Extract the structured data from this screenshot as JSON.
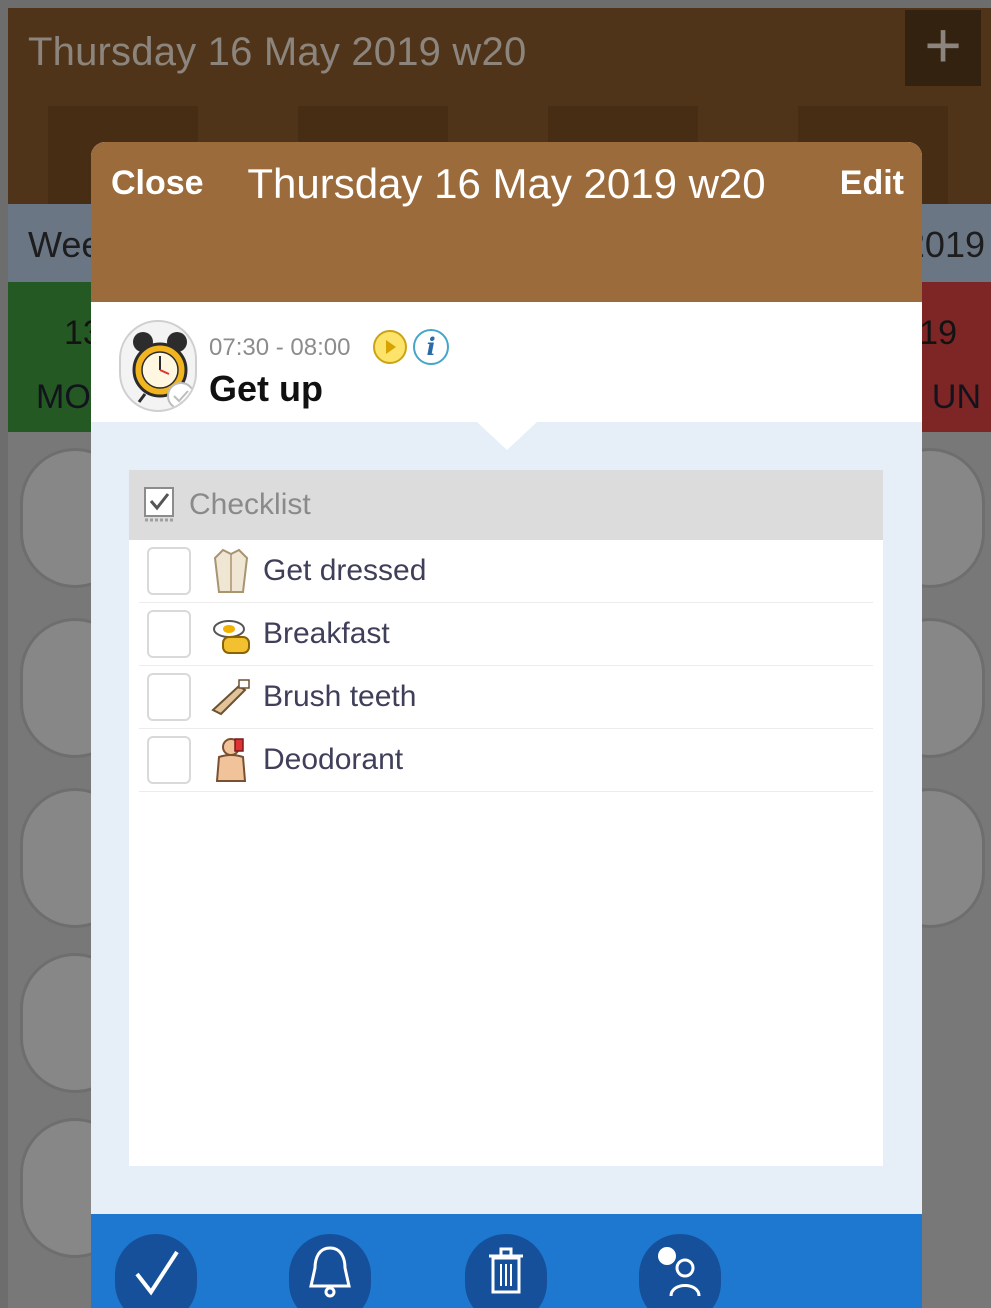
{
  "background": {
    "title": "Thursday 16 May 2019 w20",
    "add_label": "+",
    "week_left": "Wee",
    "week_right": "2019",
    "day_left_num": "13",
    "day_left_label": "MO",
    "day_right_num": "19",
    "day_right_label": "UN"
  },
  "modal": {
    "close_label": "Close",
    "title": "Thursday 16 May 2019 w20",
    "edit_label": "Edit",
    "activity": {
      "time": "07:30 - 08:00",
      "name": "Get up",
      "icon": "alarm-clock-icon"
    },
    "checklist": {
      "header": "Checklist",
      "items": [
        {
          "label": "Get dressed",
          "icon": "shirt-icon",
          "checked": false
        },
        {
          "label": "Breakfast",
          "icon": "breakfast-icon",
          "checked": false
        },
        {
          "label": "Brush teeth",
          "icon": "toothbrush-icon",
          "checked": false
        },
        {
          "label": "Deodorant",
          "icon": "deodorant-icon",
          "checked": false
        }
      ]
    },
    "toolbar": {
      "buttons": [
        "checkmark-icon",
        "bell-icon",
        "trash-icon",
        "user-comment-icon"
      ]
    }
  },
  "colors": {
    "header_brown": "#9c6b3c",
    "toolbar_blue": "#1e78d0",
    "panel_bg": "#e6eff8"
  }
}
